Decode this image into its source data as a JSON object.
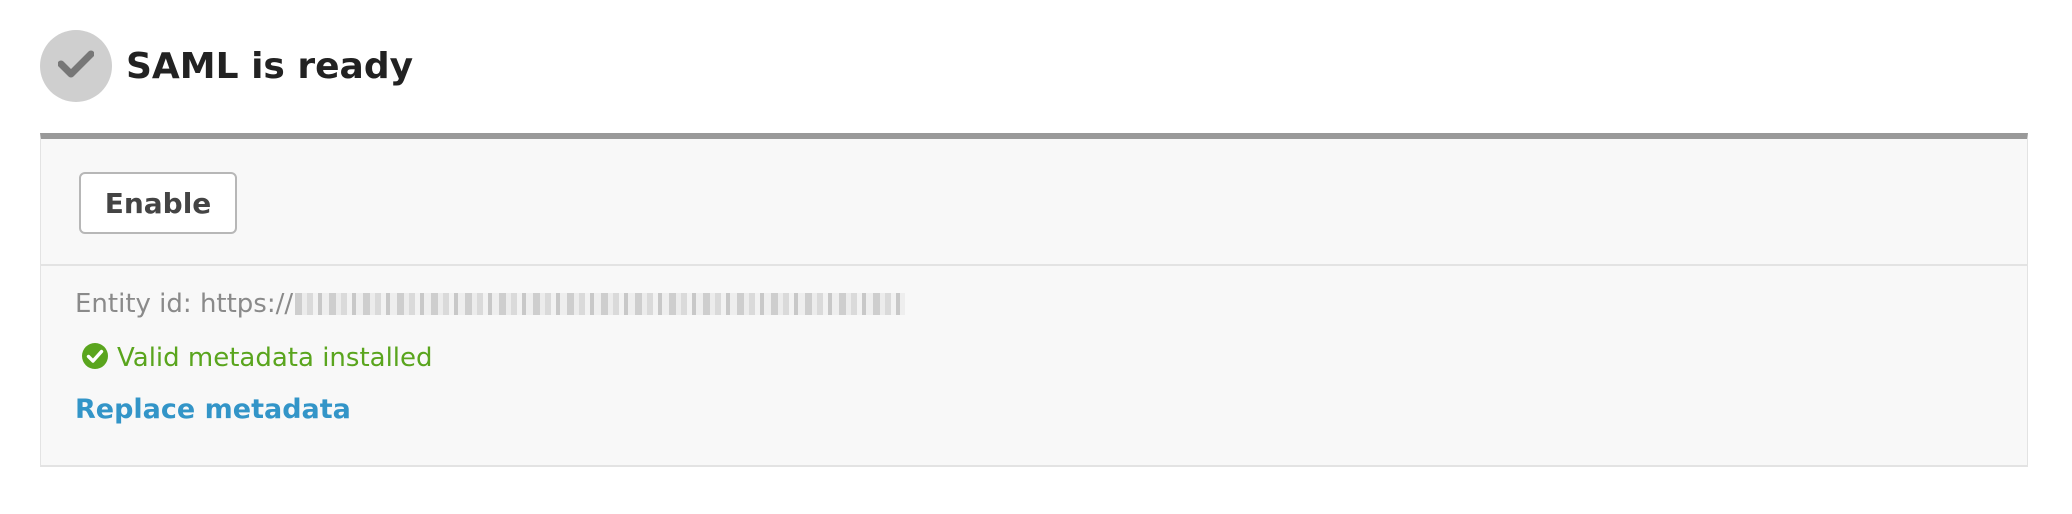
{
  "header": {
    "status_icon": "checkmark-icon",
    "title": "SAML is ready"
  },
  "toolbar": {
    "enable_label": "Enable"
  },
  "details": {
    "entity_label": "Entity id:",
    "entity_url_prefix": "https://",
    "entity_url_redacted": true,
    "valid_icon": "check-circle-icon",
    "valid_status": "Valid metadata installed",
    "replace_link": "Replace metadata"
  },
  "colors": {
    "status_circle": "#cfcfcf",
    "panel_border_top": "#999999",
    "success_green": "#5aa51e",
    "link_blue": "#3395c8"
  }
}
